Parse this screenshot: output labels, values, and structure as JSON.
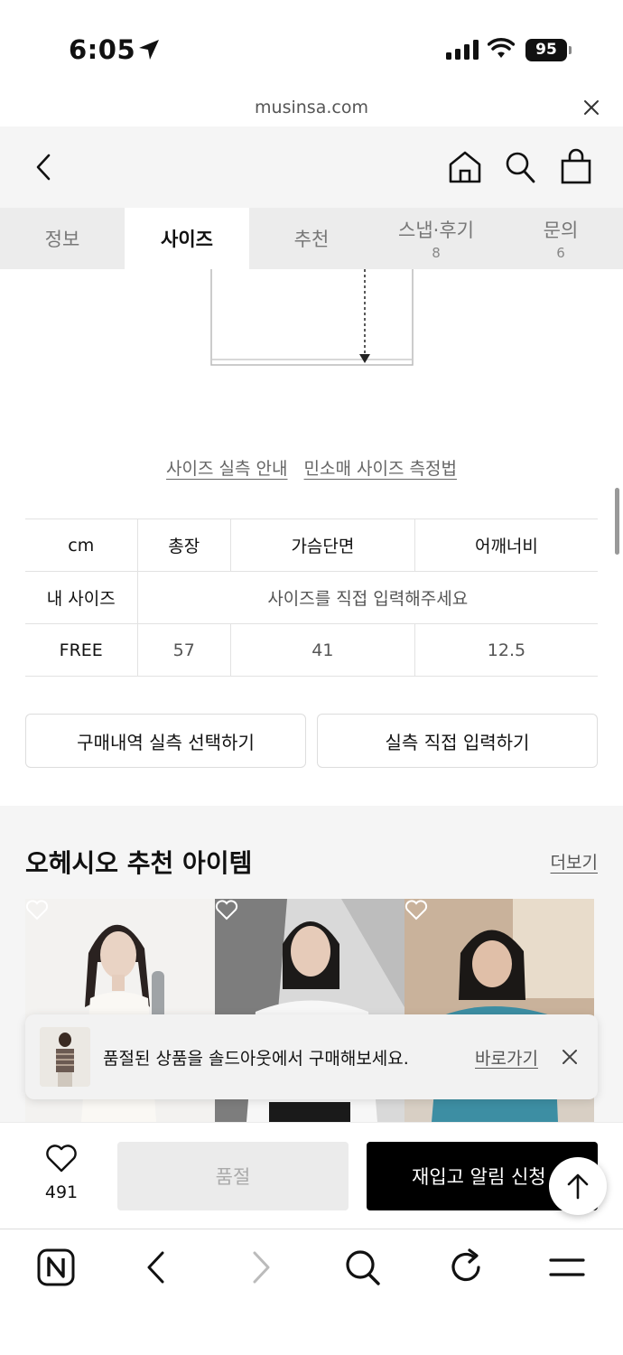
{
  "status": {
    "time": "6:05",
    "battery": "95"
  },
  "browser": {
    "url": "musinsa.com"
  },
  "tabs": [
    {
      "label": "정보",
      "count": ""
    },
    {
      "label": "사이즈",
      "count": ""
    },
    {
      "label": "추천",
      "count": ""
    },
    {
      "label": "스냅·후기",
      "count": "8"
    },
    {
      "label": "문의",
      "count": "6"
    }
  ],
  "size_links": {
    "guide": "사이즈 실측 안내",
    "method": "민소매 사이즈 측정법"
  },
  "size_table": {
    "unit": "cm",
    "columns": [
      "총장",
      "가슴단면",
      "어깨너비"
    ],
    "my_size_label": "내 사이즈",
    "my_size_prompt": "사이즈를 직접 입력해주세요",
    "rows": [
      {
        "size": "FREE",
        "values": [
          "57",
          "41",
          "12.5"
        ]
      }
    ]
  },
  "buttons": {
    "purchase_history": "구매내역 실측 선택하기",
    "direct_input": "실측 직접 입력하기"
  },
  "recommend": {
    "title": "오헤시오 추천 아이템",
    "more": "더보기"
  },
  "toast": {
    "message": "품절된 상품을 솔드아웃에서 구매해보세요.",
    "link": "바로가기"
  },
  "action_bar": {
    "like_count": "491",
    "soldout": "품절",
    "restock": "재입고 알림 신청"
  }
}
